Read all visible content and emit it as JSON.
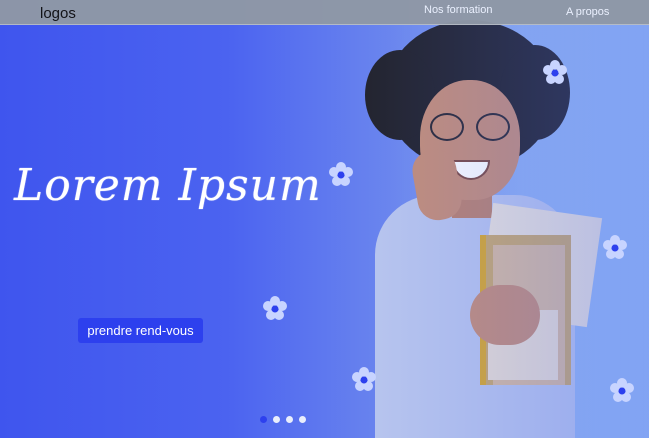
{
  "header": {
    "logo": "logos",
    "nav": [
      {
        "label": "Nos formation"
      },
      {
        "label": "A propos"
      }
    ]
  },
  "hero": {
    "title": "Lorem Ipsum",
    "cta_label": "prendre rend-vous",
    "carousel": {
      "count": 4,
      "active_index": 0
    }
  },
  "colors": {
    "primary": "#2d40ee",
    "gradient_start": "#3f55ee",
    "gradient_end": "#9cc0f5",
    "flower": "#c8d4ff",
    "flower_center": "#2d40ee"
  },
  "icons": [
    "flower-icon"
  ]
}
